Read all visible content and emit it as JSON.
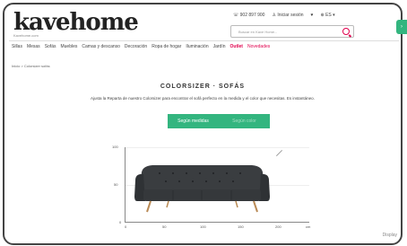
{
  "header": {
    "logo": "kavehome",
    "tagline": "Kavehome.com",
    "phone": "902 897 900",
    "account": "Iniciar sesión",
    "wishlist_icon": "heart-icon",
    "lang": "ES",
    "search_placeholder": "Buscar en Kave Home...",
    "side_tab": "›"
  },
  "nav": {
    "items": [
      "Sillas",
      "Mesas",
      "Sofás",
      "Muebles",
      "Camas y descanso",
      "Decoración",
      "Ropa de hogar",
      "Iluminación",
      "Jardín"
    ],
    "sale": "Outlet",
    "new": "Novedades"
  },
  "breadcrumb": "Inicio > Colorsizer sofás",
  "page": {
    "title": "COLORSIZER · SOFÁS",
    "description": "Ajusta la Reparta de nuestro Colorsizer para encontrar el sofá perfecto en la medida y el color que necesitas. Es instantáneo."
  },
  "tabs": [
    "Según medidas",
    "Según color"
  ],
  "chart": {
    "y_ticks": [
      "100",
      "50",
      "0"
    ],
    "x_ticks": [
      "0",
      "50",
      "100",
      "150",
      "200"
    ],
    "x_unit": "cm",
    "expand_icon": "expand-icon"
  },
  "watermark": "Display"
}
